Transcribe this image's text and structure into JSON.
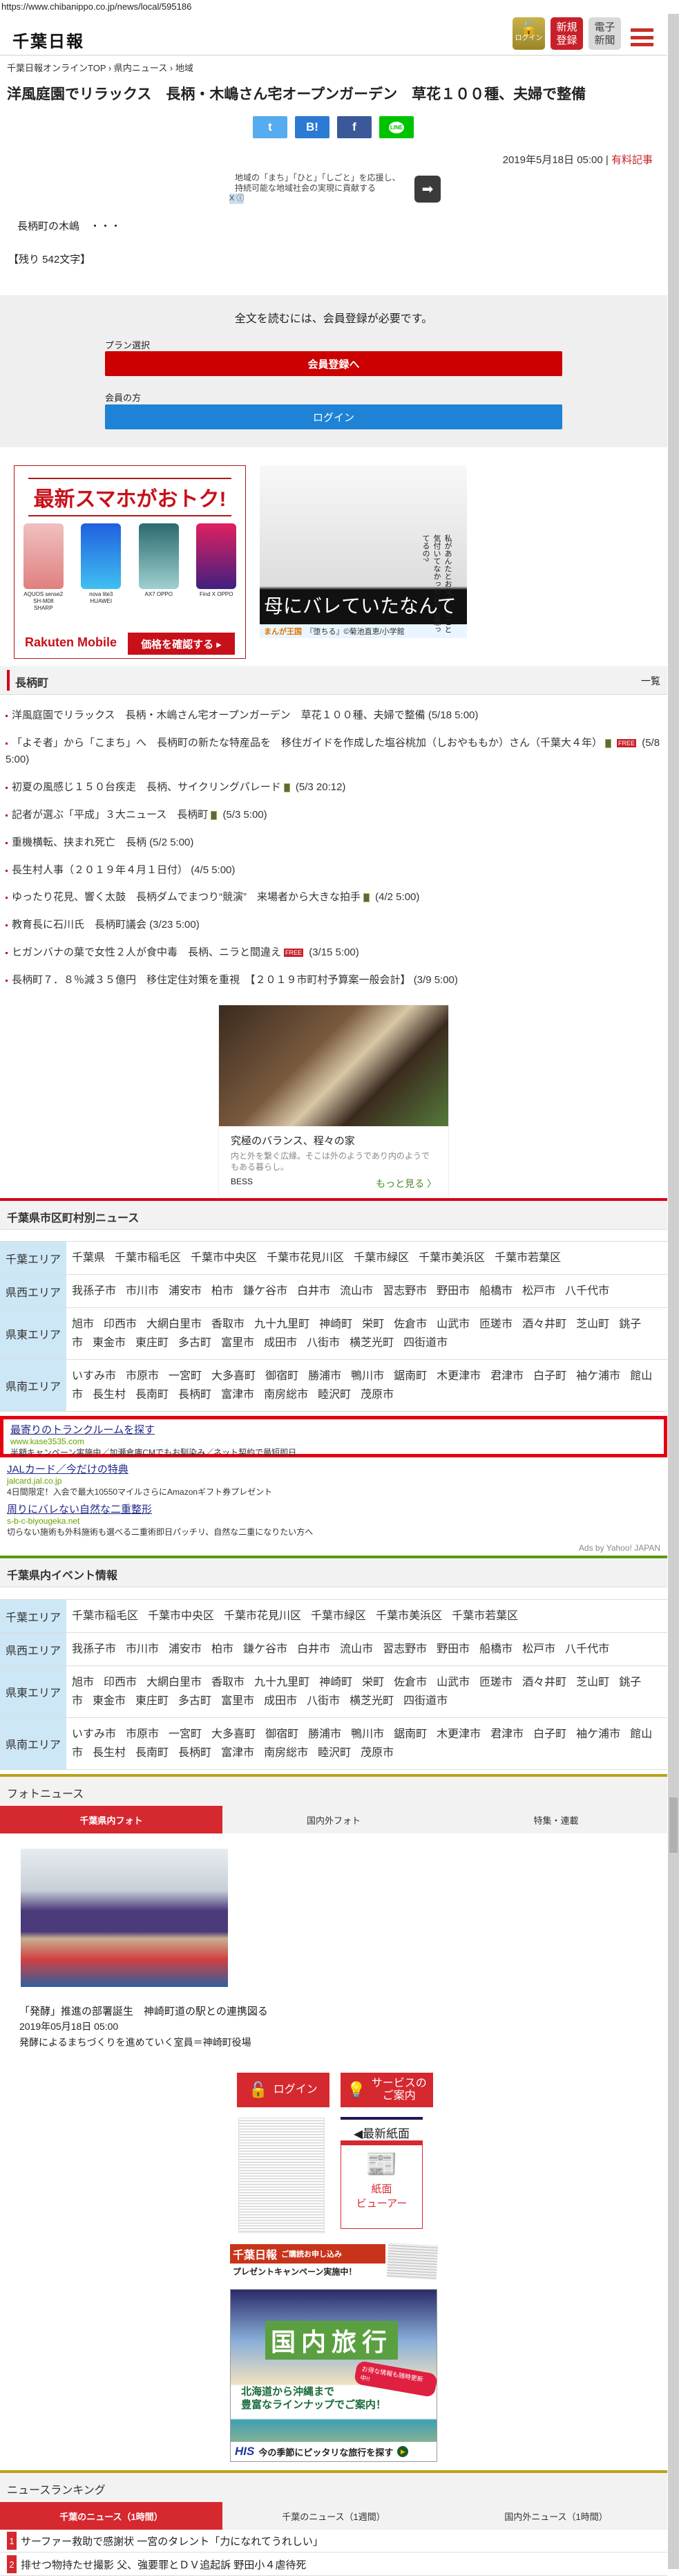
{
  "browser": {
    "url": "https://www.chibanippo.co.jp/news/local/595186"
  },
  "header": {
    "logo": "千葉日報",
    "login": "ログイン",
    "register": "新規登録",
    "register_l1": "新規",
    "register_l2": "登録",
    "epaper_l1": "電子",
    "epaper_l2": "新聞"
  },
  "breadcrumb": [
    "千葉日報オンラインTOP",
    "›",
    "県内ニュース",
    "›",
    "地域"
  ],
  "article": {
    "title": "洋風庭園でリラックス　長柄・木嶋さん宅オープンガーデン　草花１００種、夫婦で整備",
    "share": {
      "twitter": "t",
      "hatena": "B!",
      "facebook": "f",
      "line": "LINE"
    },
    "date": "2019年5月18日 05:00",
    "separator": "|",
    "paid_label": "有料記事",
    "sdg_text": "地域の「まち」「ひと」「しごと」を応援し、持続可能な地域社会の実現に貢献する",
    "ad_marker": "X ⓘ",
    "lead": "長柄町の木嶋　・・・",
    "remaining": "【残り 542文字】"
  },
  "paywall": {
    "message": "全文を読むには、会員登録が必要です。",
    "plan_label": "プラン選択",
    "register_button": "会員登録へ",
    "member_label": "会員の方",
    "login_button": "ログイン"
  },
  "ads": {
    "rakuten": {
      "headline": "最新スマホがおトク!",
      "phones": [
        "AQUOS sense2 SH-M08 SHARP",
        "nova lite3 HUAWEI",
        "AX7 OPPO",
        "Find X OPPO"
      ],
      "brand": "Rakuten Mobile",
      "cta": "価格を確認する ▸"
    },
    "manga": {
      "headline": "母にバレていたなんて",
      "speech": "私があんたとお父さんのこと気付いてなかったとでも思ってるの?",
      "source": "まんが王国",
      "credit": "『堕ちる』©菊池直恵/小学館"
    },
    "bess": {
      "title": "究極のバランス、程々の家",
      "desc": "内と外を繋ぐ広縁。そこは外のようであり内のようでもある暮らし。",
      "brand": "BESS",
      "more": "もっと見る 〉"
    }
  },
  "town": {
    "title": "長柄町",
    "all_link": "一覧",
    "items": [
      {
        "text": "洋風庭園でリラックス　長柄・木嶋さん宅オープンガーデン　草花１００種、夫婦で整備",
        "time": "(5/18 5:00)",
        "mobile": false,
        "free": false
      },
      {
        "text": "「よそ者」から「こまち」へ　長柄町の新たな特産品を　移住ガイドを作成した塩谷桃加（しおやももか）さん（千葉大４年）",
        "time": "(5/8 5:00)",
        "mobile": true,
        "free": true
      },
      {
        "text": "初夏の風感じ１５０台疾走　長柄、サイクリングパレード",
        "time": "(5/3 20:12)",
        "mobile": true,
        "free": false
      },
      {
        "text": "記者が選ぶ「平成」３大ニュース　長柄町",
        "time": "(5/3 5:00)",
        "mobile": true,
        "free": false
      },
      {
        "text": "重機横転、挟まれ死亡　長柄",
        "time": "(5/2 5:00)",
        "mobile": false,
        "free": false
      },
      {
        "text": "長生村人事（２０１９年４月１日付）",
        "time": "(4/5 5:00)",
        "mobile": false,
        "free": false
      },
      {
        "text": "ゆったり花見、響く太鼓　長柄ダムでまつり“競演”　来場者から大きな拍手",
        "time": "(4/2 5:00)",
        "mobile": true,
        "free": false
      },
      {
        "text": "教育長に石川氏　長柄町議会",
        "time": "(3/23 5:00)",
        "mobile": false,
        "free": false
      },
      {
        "text": "ヒガンバナの葉で女性２人が食中毒　長柄、ニラと間違え",
        "time": "(3/15 5:00)",
        "mobile": false,
        "free": true
      },
      {
        "text": "長柄町７．８％減３５億円　移住定住対策を重視　【２０１９市町村予算案一般会計】",
        "time": "(3/9 5:00)",
        "mobile": false,
        "free": false
      }
    ],
    "free_badge": "FREE"
  },
  "city_news": {
    "title": "千葉県市区町村別ニュース",
    "areas": [
      {
        "label": "千葉エリア",
        "cities": [
          "千葉県",
          "千葉市稲毛区",
          "千葉市中央区",
          "千葉市花見川区",
          "千葉市緑区",
          "千葉市美浜区",
          "千葉市若葉区"
        ]
      },
      {
        "label": "県西エリア",
        "cities": [
          "我孫子市",
          "市川市",
          "浦安市",
          "柏市",
          "鎌ケ谷市",
          "白井市",
          "流山市",
          "習志野市",
          "野田市",
          "船橋市",
          "松戸市",
          "八千代市"
        ]
      },
      {
        "label": "県東エリア",
        "cities": [
          "旭市",
          "印西市",
          "大網白里市",
          "香取市",
          "九十九里町",
          "神崎町",
          "栄町",
          "佐倉市",
          "山武市",
          "匝瑳市",
          "酒々井町",
          "芝山町",
          "銚子市",
          "東金市",
          "東庄町",
          "多古町",
          "富里市",
          "成田市",
          "八街市",
          "横芝光町",
          "四街道市"
        ]
      },
      {
        "label": "県南エリア",
        "cities": [
          "いすみ市",
          "市原市",
          "一宮町",
          "大多喜町",
          "御宿町",
          "勝浦市",
          "鴨川市",
          "鋸南町",
          "木更津市",
          "君津市",
          "白子町",
          "袖ケ浦市",
          "館山市",
          "長生村",
          "長南町",
          "長柄町",
          "富津市",
          "南房総市",
          "睦沢町",
          "茂原市"
        ]
      }
    ]
  },
  "yahoo_ads": {
    "items": [
      {
        "title": "最寄りのトランクルームを探す",
        "url": "www.kase3535.com",
        "desc": "半額キャンペーン実施中／加瀬倉庫CMでもお馴染み／ネット契約で最短即日"
      },
      {
        "title": "JALカード／今だけの特典",
        "url": "jalcard.jal.co.jp",
        "desc": "4日間限定！入会で最大10550マイルさらにAmazonギフト券プレゼント"
      },
      {
        "title": "周りにバレない自然な二重整形",
        "url": "s-b-c-biyougeka.net",
        "desc": "切らない施術も外科施術も選べる二重術即日パッチリ、自然な二重になりたい方へ"
      }
    ],
    "credit": "Ads by Yahoo! JAPAN"
  },
  "events": {
    "title": "千葉県内イベント情報",
    "areas": [
      {
        "label": "千葉エリア",
        "cities": [
          "千葉市稲毛区",
          "千葉市中央区",
          "千葉市花見川区",
          "千葉市緑区",
          "千葉市美浜区",
          "千葉市若葉区"
        ]
      },
      {
        "label": "県西エリア",
        "cities": [
          "我孫子市",
          "市川市",
          "浦安市",
          "柏市",
          "鎌ケ谷市",
          "白井市",
          "流山市",
          "習志野市",
          "野田市",
          "船橋市",
          "松戸市",
          "八千代市"
        ]
      },
      {
        "label": "県東エリア",
        "cities": [
          "旭市",
          "印西市",
          "大網白里市",
          "香取市",
          "九十九里町",
          "神崎町",
          "栄町",
          "佐倉市",
          "山武市",
          "匝瑳市",
          "酒々井町",
          "芝山町",
          "銚子市",
          "東金市",
          "東庄町",
          "多古町",
          "富里市",
          "成田市",
          "八街市",
          "横芝光町",
          "四街道市"
        ]
      },
      {
        "label": "県南エリア",
        "cities": [
          "いすみ市",
          "市原市",
          "一宮町",
          "大多喜町",
          "御宿町",
          "勝浦市",
          "鴨川市",
          "鋸南町",
          "木更津市",
          "君津市",
          "白子町",
          "袖ケ浦市",
          "館山市",
          "長生村",
          "長南町",
          "長柄町",
          "富津市",
          "南房総市",
          "睦沢町",
          "茂原市"
        ]
      }
    ]
  },
  "photo_news": {
    "title": "フォトニュース",
    "tabs": [
      "千葉県内フォト",
      "国内外フォト",
      "特集・連載"
    ],
    "caption": "「発酵」推進の部署誕生　神崎町道の駅との連携図る",
    "date": "2019年05月18日 05:00",
    "desc": "発酵によるまちづくりを進めていく室員＝神崎町役場"
  },
  "side": {
    "login": "ログイン",
    "service_l1": "サービスの",
    "service_l2": "ご案内",
    "latest": "◀最新紙面",
    "viewer_l1": "紙面",
    "viewer_l2": "ビューアー",
    "subscribe_logo": "千葉日報",
    "subscribe": "ご購読お申し込み",
    "campaign": "プレゼントキャンペーン実施中！"
  },
  "his_ad": {
    "headline": "国内旅行",
    "badge": "お得な情報も随時更新中!!",
    "copy_l1": "北海道から沖縄まで",
    "copy_l2": "豊富なラインナップでご案内！",
    "brand": "HIS",
    "cta": "今の季節にピッタリな旅行を探す"
  },
  "ranking": {
    "title": "ニュースランキング",
    "tabs": [
      "千葉のニュース（1時間）",
      "千葉のニュース（1週間）",
      "国内外ニュース（1時間）"
    ],
    "items": [
      {
        "rank": "1",
        "text": "サーファー救助で感謝状 一宮のタレント「力になれてうれしい」"
      },
      {
        "rank": "2",
        "text": "排せつ物持たせ撮影 父、強要罪とＤＶ追起訴 野田小４虐待死"
      }
    ]
  },
  "colors": {
    "red": "#d6282f",
    "blue": "#1e83d6",
    "gold": "#b8a219",
    "green": "#5a9a0f"
  }
}
